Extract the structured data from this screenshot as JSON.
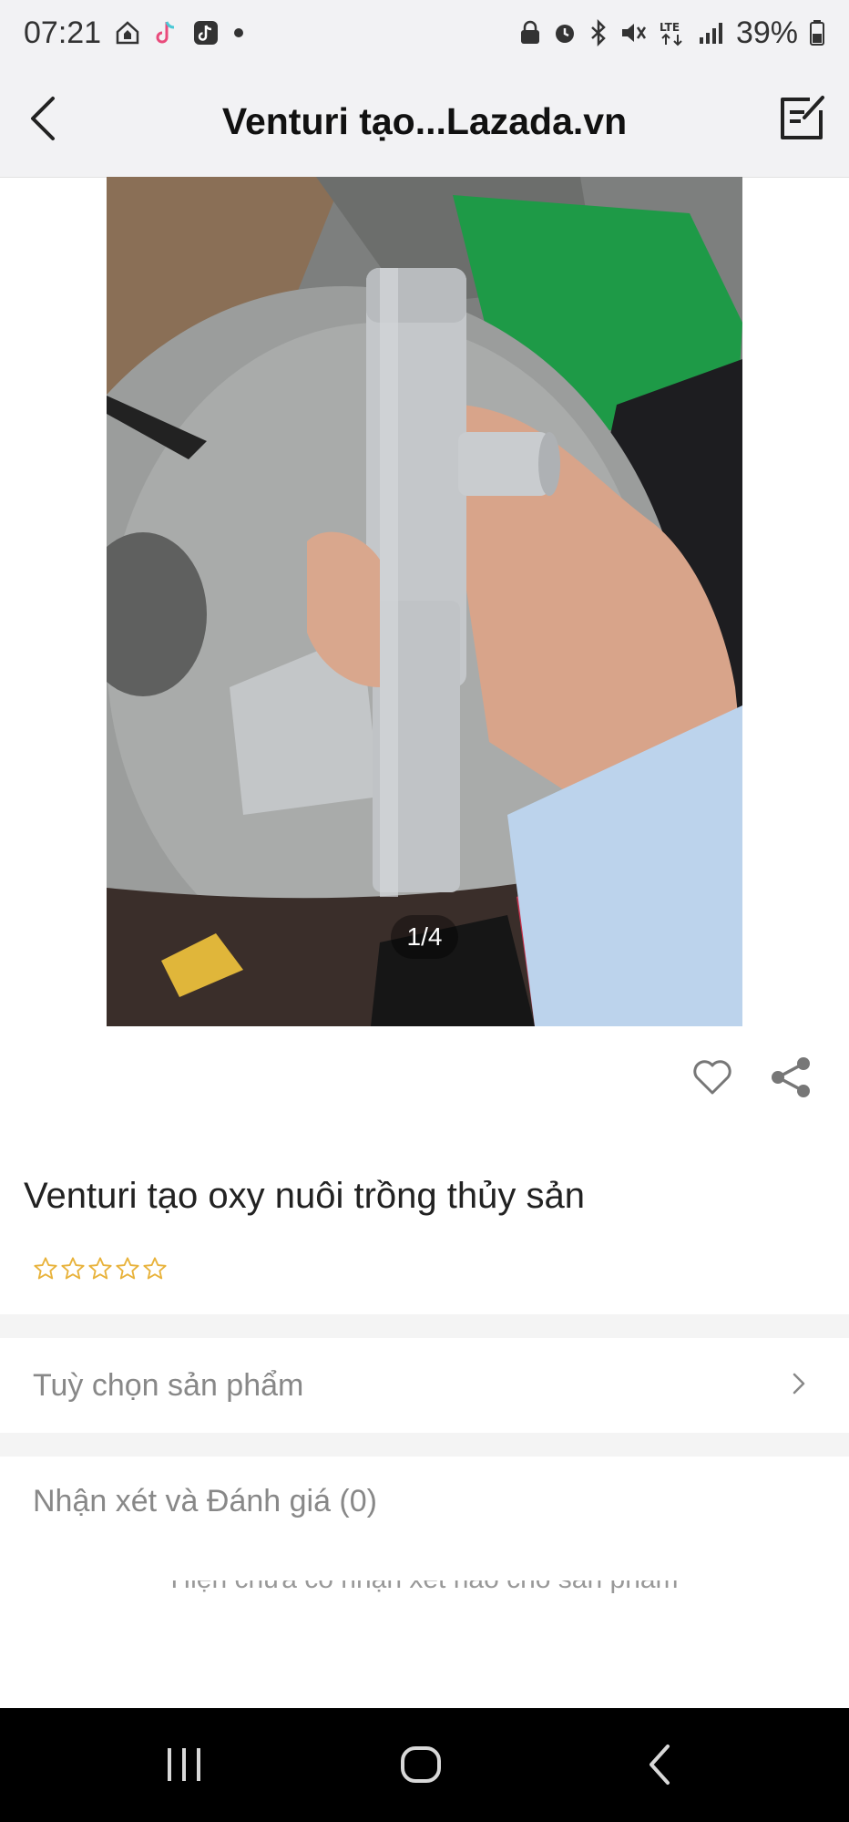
{
  "status_bar": {
    "time": "07:21",
    "battery_percent": "39%",
    "icons_left": [
      "home-shield-icon",
      "tiktok-icon",
      "tiktok-icon",
      "dot-icon"
    ],
    "icons_right": [
      "lock-icon",
      "alarm-icon",
      "bluetooth-icon",
      "mute-icon",
      "lte-icon",
      "signal-icon",
      "battery-icon"
    ]
  },
  "header": {
    "title": "Venturi tạo...Lazada.vn",
    "back_icon": "chevron-left-icon",
    "edit_icon": "edit-note-icon"
  },
  "gallery": {
    "counter": "1/4"
  },
  "actions": {
    "favorite_icon": "heart-icon",
    "share_icon": "share-icon"
  },
  "product": {
    "title": "Venturi tạo oxy nuôi trồng thủy sản",
    "rating_stars_filled": 0,
    "rating_stars_total": 5
  },
  "options": {
    "label": "Tuỳ chọn sản phẩm"
  },
  "reviews": {
    "title": "Nhận xét và Đánh giá (0)",
    "empty_text": "Hiện chưa có nhận xét nào cho sản phẩm"
  },
  "colors": {
    "header_bg": "#f2f2f4",
    "star": "#e8b23a",
    "nav_bg": "#000000"
  }
}
